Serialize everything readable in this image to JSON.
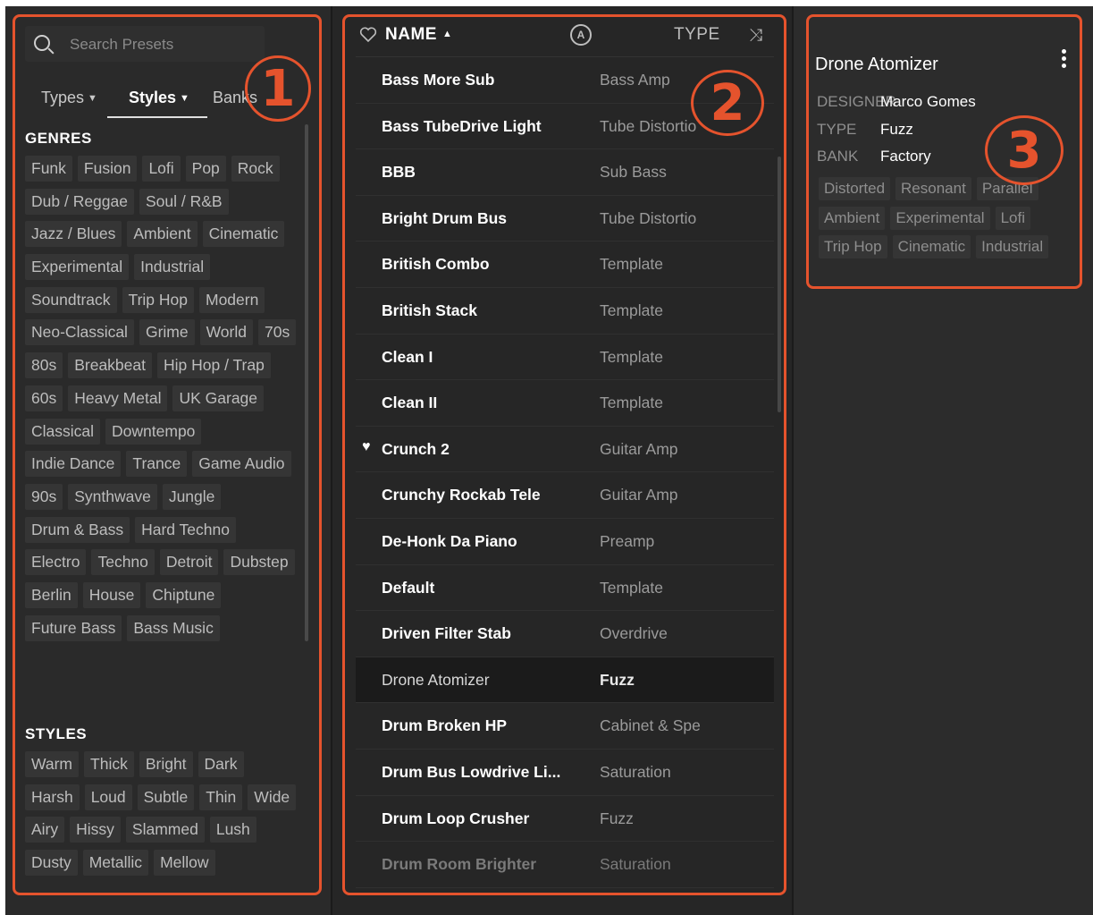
{
  "search": {
    "placeholder": "Search Presets"
  },
  "filter_tabs": [
    {
      "label": "Types"
    },
    {
      "label": "Styles"
    },
    {
      "label": "Banks"
    }
  ],
  "genres": {
    "title": "GENRES",
    "tags": [
      "Funk",
      "Fusion",
      "Lofi",
      "Pop",
      "Rock",
      "Dub / Reggae",
      "Soul / R&B",
      "Jazz / Blues",
      "Ambient",
      "Cinematic",
      "Experimental",
      "Industrial",
      "Soundtrack",
      "Trip Hop",
      "Modern",
      "Neo-Classical",
      "Grime",
      "World",
      "70s",
      "80s",
      "Breakbeat",
      "Hip Hop / Trap",
      "60s",
      "Heavy Metal",
      "UK Garage",
      "Classical",
      "Downtempo",
      "Indie Dance",
      "Trance",
      "Game Audio",
      "90s",
      "Synthwave",
      "Jungle",
      "Drum & Bass",
      "Hard Techno",
      "Electro",
      "Techno",
      "Detroit",
      "Dubstep",
      "Berlin",
      "House",
      "Chiptune",
      "Future Bass",
      "Bass Music"
    ]
  },
  "styles": {
    "title": "STYLES",
    "tags": [
      "Warm",
      "Thick",
      "Bright",
      "Dark",
      "Harsh",
      "Loud",
      "Subtle",
      "Thin",
      "Wide",
      "Airy",
      "Hissy",
      "Slammed",
      "Lush",
      "Dusty",
      "Metallic",
      "Mellow"
    ]
  },
  "list_header": {
    "name_label": "NAME",
    "type_label": "TYPE"
  },
  "presets": [
    {
      "name": "Bass More Sub",
      "type": "Bass Amp",
      "favorite": false
    },
    {
      "name": "Bass TubeDrive Light",
      "type": "Tube Distortio",
      "favorite": false
    },
    {
      "name": "BBB",
      "type": "Sub Bass",
      "favorite": false
    },
    {
      "name": "Bright Drum Bus",
      "type": "Tube Distortio",
      "favorite": false
    },
    {
      "name": "British Combo",
      "type": "Template",
      "favorite": false
    },
    {
      "name": "British Stack",
      "type": "Template",
      "favorite": false
    },
    {
      "name": "Clean I",
      "type": "Template",
      "favorite": false
    },
    {
      "name": "Clean II",
      "type": "Template",
      "favorite": false
    },
    {
      "name": "Crunch 2",
      "type": "Guitar Amp",
      "favorite": true
    },
    {
      "name": "Crunchy Rockab Tele",
      "type": "Guitar Amp",
      "favorite": false
    },
    {
      "name": "De-Honk Da Piano",
      "type": "Preamp",
      "favorite": false
    },
    {
      "name": "Default",
      "type": "Template",
      "favorite": false
    },
    {
      "name": "Driven Filter Stab",
      "type": "Overdrive",
      "favorite": false
    },
    {
      "name": "Drone Atomizer",
      "type": "Fuzz",
      "favorite": false,
      "selected": true
    },
    {
      "name": "Drum Broken HP",
      "type": "Cabinet & Spe",
      "favorite": false
    },
    {
      "name": "Drum Bus Lowdrive Li...",
      "type": "Saturation",
      "favorite": false
    },
    {
      "name": "Drum Loop Crusher",
      "type": "Fuzz",
      "favorite": false
    },
    {
      "name": "Drum Room Brighter",
      "type": "Saturation",
      "favorite": false,
      "dim": true
    }
  ],
  "preset_info": {
    "title": "Drone Atomizer",
    "designer_label": "DESIGNER",
    "designer": "Marco Gomes",
    "type_label": "TYPE",
    "type": "Fuzz",
    "bank_label": "BANK",
    "bank": "Factory",
    "tags": [
      "Distorted",
      "Resonant",
      "Parallel",
      "Ambient",
      "Experimental",
      "Lofi",
      "Trip Hop",
      "Cinematic",
      "Industrial"
    ]
  },
  "callouts": [
    "1",
    "2",
    "3"
  ],
  "accent_color": "#e5532d",
  "icons": [
    "search-icon",
    "chevron-down-icon",
    "heart-icon",
    "arturia-icon",
    "shuffle-icon",
    "kebab-menu-icon"
  ]
}
